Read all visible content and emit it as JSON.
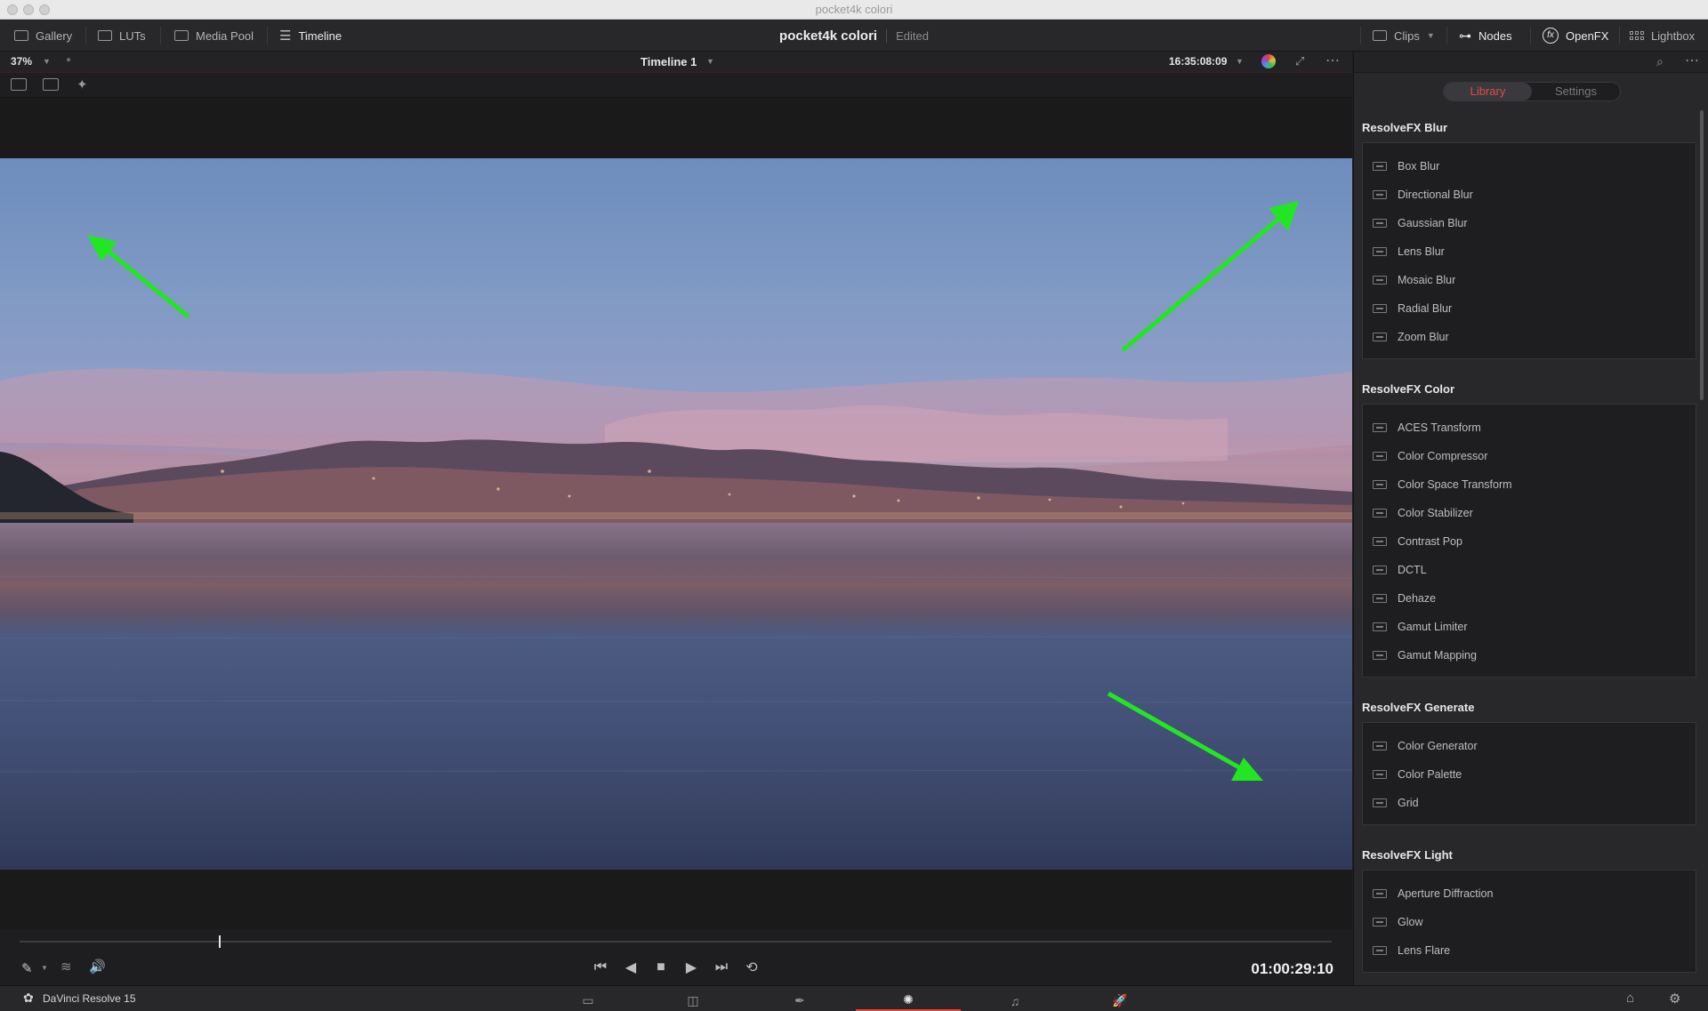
{
  "window": {
    "title": "pocket4k colori"
  },
  "toolbar": {
    "gallery": "Gallery",
    "luts": "LUTs",
    "media_pool": "Media Pool",
    "timeline": "Timeline",
    "project_name": "pocket4k colori",
    "project_status": "Edited",
    "clips": "Clips",
    "nodes": "Nodes",
    "openfx": "OpenFX",
    "lightbox": "Lightbox"
  },
  "viewer": {
    "zoom": "37%",
    "timeline_name": "Timeline 1",
    "source_timecode": "16:35:08:09",
    "record_timecode": "01:00:29:10",
    "playhead_fraction": 0.152
  },
  "panel": {
    "tab_library": "Library",
    "tab_settings": "Settings",
    "sections": [
      {
        "title": "ResolveFX Blur",
        "items": [
          "Box Blur",
          "Directional Blur",
          "Gaussian Blur",
          "Lens Blur",
          "Mosaic Blur",
          "Radial Blur",
          "Zoom Blur"
        ]
      },
      {
        "title": "ResolveFX Color",
        "items": [
          "ACES Transform",
          "Color Compressor",
          "Color Space Transform",
          "Color Stabilizer",
          "Contrast Pop",
          "DCTL",
          "Dehaze",
          "Gamut Limiter",
          "Gamut Mapping"
        ]
      },
      {
        "title": "ResolveFX Generate",
        "items": [
          "Color Generator",
          "Color Palette",
          "Grid"
        ]
      },
      {
        "title": "ResolveFX Light",
        "items": [
          "Aperture Diffraction",
          "Glow",
          "Lens Flare"
        ]
      }
    ]
  },
  "bottombar": {
    "app_name": "DaVinci Resolve 15"
  },
  "colors": {
    "accent": "#e0443e",
    "annotation_arrow": "#22e622"
  }
}
